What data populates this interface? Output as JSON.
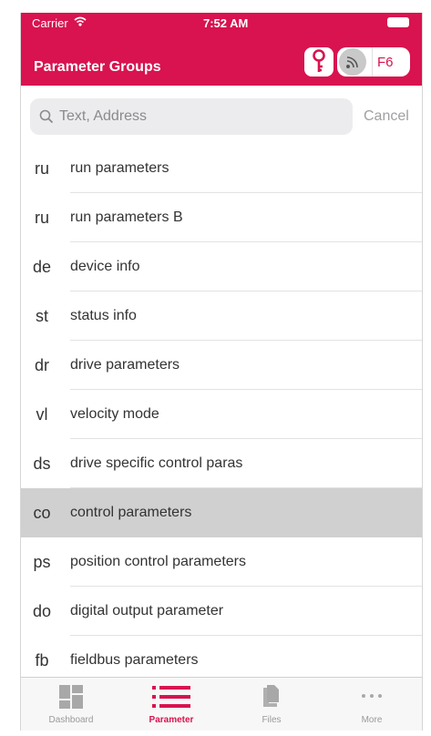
{
  "status": {
    "carrier": "Carrier",
    "time": "7:52 AM"
  },
  "header": {
    "title": "Parameter Groups",
    "function_key": "F6"
  },
  "search": {
    "placeholder": "Text, Address",
    "value": "",
    "cancel_label": "Cancel"
  },
  "groups": [
    {
      "code": "ru",
      "label": "run parameters"
    },
    {
      "code": "ru",
      "label": "run parameters B"
    },
    {
      "code": "de",
      "label": "device info"
    },
    {
      "code": "st",
      "label": "status info"
    },
    {
      "code": "dr",
      "label": "drive parameters"
    },
    {
      "code": "vl",
      "label": "velocity mode"
    },
    {
      "code": "ds",
      "label": "drive specific control paras"
    },
    {
      "code": "co",
      "label": "control parameters",
      "selected": true
    },
    {
      "code": "ps",
      "label": "position control parameters"
    },
    {
      "code": "do",
      "label": "digital output parameter"
    },
    {
      "code": "fb",
      "label": "fieldbus parameters"
    }
  ],
  "tabs": [
    {
      "label": "Dashboard",
      "icon": "dashboard-icon"
    },
    {
      "label": "Parameter",
      "icon": "list-icon",
      "active": true
    },
    {
      "label": "Files",
      "icon": "files-icon"
    },
    {
      "label": "More",
      "icon": "more-icon"
    }
  ],
  "colors": {
    "accent": "#d8134f",
    "selected_row": "#d0d0d0",
    "inactive_tab": "#9a9a9a"
  }
}
